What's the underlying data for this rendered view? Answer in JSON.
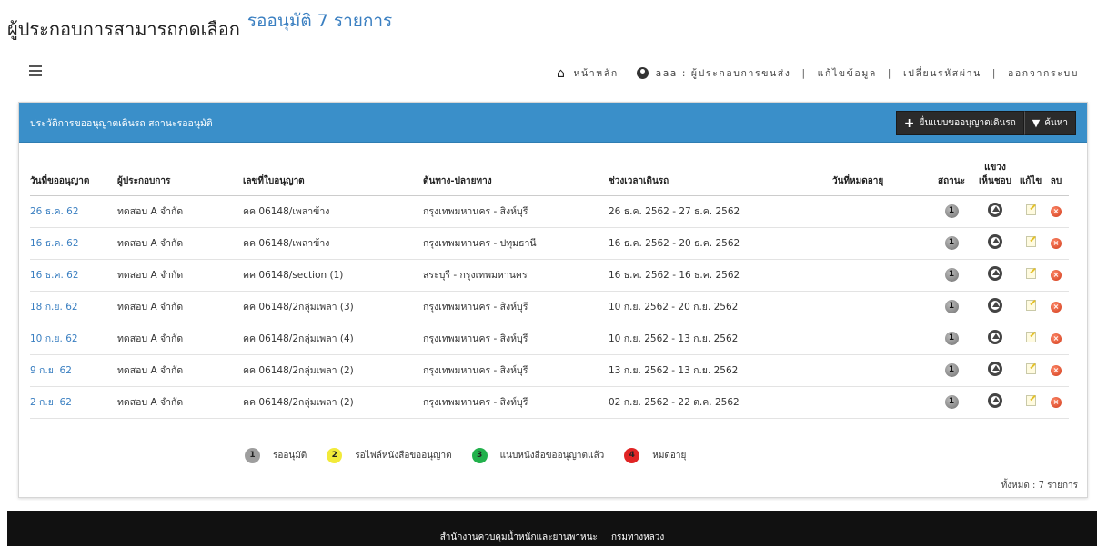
{
  "heading": {
    "lead": "ผู้ประกอบการสามารถกดเลือก",
    "count": "รออนุมัติ 7 รายการ"
  },
  "nav": {
    "home": "หน้าหลัก",
    "user": "aaa : ผู้ประกอบการขนส่ง",
    "sep": "|",
    "edit": "แก้ไขข้อมูล",
    "password": "เปลี่ยนรหัสผ่าน",
    "logout": "ออกจากระบบ"
  },
  "panel": {
    "title": "ประวัติการขออนุญาตเดินรถ สถานะรออนุมัติ",
    "new_button": "ยื่นแบบขออนุญาตเดินรถ",
    "search_button": "ค้นหา"
  },
  "table": {
    "headers": {
      "request_date": "วันที่ขออนุญาต",
      "operator": "ผู้ประกอบการ",
      "permit_no": "เลขที่ใบอนุญาต",
      "route": "ต้นทาง-ปลายทาง",
      "period": "ช่วงเวลาเดินรถ",
      "expiry": "วันที่หมดอายุ",
      "status": "สถานะ",
      "view_l1": "แขวง",
      "view_l2": "เห็นชอบ",
      "edit": "แก้ไข",
      "delete": "ลบ"
    },
    "status_value": "1",
    "rows": [
      {
        "date": "26 ธ.ค. 62",
        "operator": "ทดสอบ A จำกัด",
        "permit": "คค 06148/เพลาข้าง",
        "route": "กรุงเทพมหานคร - สิงห์บุรี",
        "period": "26 ธ.ค. 2562 - 27 ธ.ค. 2562",
        "expiry": ""
      },
      {
        "date": "16 ธ.ค. 62",
        "operator": "ทดสอบ A จำกัด",
        "permit": "คค 06148/เพลาข้าง",
        "route": "กรุงเทพมหานคร - ปทุมธานี",
        "period": "16 ธ.ค. 2562 - 20 ธ.ค. 2562",
        "expiry": ""
      },
      {
        "date": "16 ธ.ค. 62",
        "operator": "ทดสอบ A จำกัด",
        "permit": "คค 06148/section (1)",
        "route": "สระบุรี - กรุงเทพมหานคร",
        "period": "16 ธ.ค. 2562 - 16 ธ.ค. 2562",
        "expiry": ""
      },
      {
        "date": "18 ก.ย. 62",
        "operator": "ทดสอบ A จำกัด",
        "permit": "คค 06148/2กลุ่มเพลา (3)",
        "route": "กรุงเทพมหานคร - สิงห์บุรี",
        "period": "10 ก.ย. 2562 - 20 ก.ย. 2562",
        "expiry": ""
      },
      {
        "date": "10 ก.ย. 62",
        "operator": "ทดสอบ A จำกัด",
        "permit": "คค 06148/2กลุ่มเพลา (4)",
        "route": "กรุงเทพมหานคร - สิงห์บุรี",
        "period": "10 ก.ย. 2562 - 13 ก.ย. 2562",
        "expiry": ""
      },
      {
        "date": "9 ก.ย. 62",
        "operator": "ทดสอบ A จำกัด",
        "permit": "คค 06148/2กลุ่มเพลา (2)",
        "route": "กรุงเทพมหานคร - สิงห์บุรี",
        "period": "13 ก.ย. 2562 - 13 ก.ย. 2562",
        "expiry": ""
      },
      {
        "date": "2 ก.ย. 62",
        "operator": "ทดสอบ A จำกัด",
        "permit": "คค 06148/2กลุ่มเพลา (2)",
        "route": "กรุงเทพมหานคร - สิงห์บุรี",
        "period": "02 ก.ย. 2562 - 22 ต.ค. 2562",
        "expiry": ""
      }
    ]
  },
  "legend": [
    {
      "num": "1",
      "label": "รออนุมัติ",
      "color": "#9e9e9e"
    },
    {
      "num": "2",
      "label": "รอไฟล์หนังสือขออนุญาต",
      "color": "#f2ea3a"
    },
    {
      "num": "3",
      "label": "แนบหนังสือขออนุญาตแล้ว",
      "color": "#22b14c"
    },
    {
      "num": "4",
      "label": "หมดอายุ",
      "color": "#e02424"
    }
  ],
  "total": "ทั้งหมด : 7 รายการ",
  "footer": {
    "org": "สำนักงานควบคุมน้ำหนักและยานพาหนะ",
    "dept": "กรมทางหลวง"
  },
  "colors": {
    "header_blue": "#3a8fc9",
    "link_blue": "#3a7fc1",
    "footer_black": "#111111"
  }
}
